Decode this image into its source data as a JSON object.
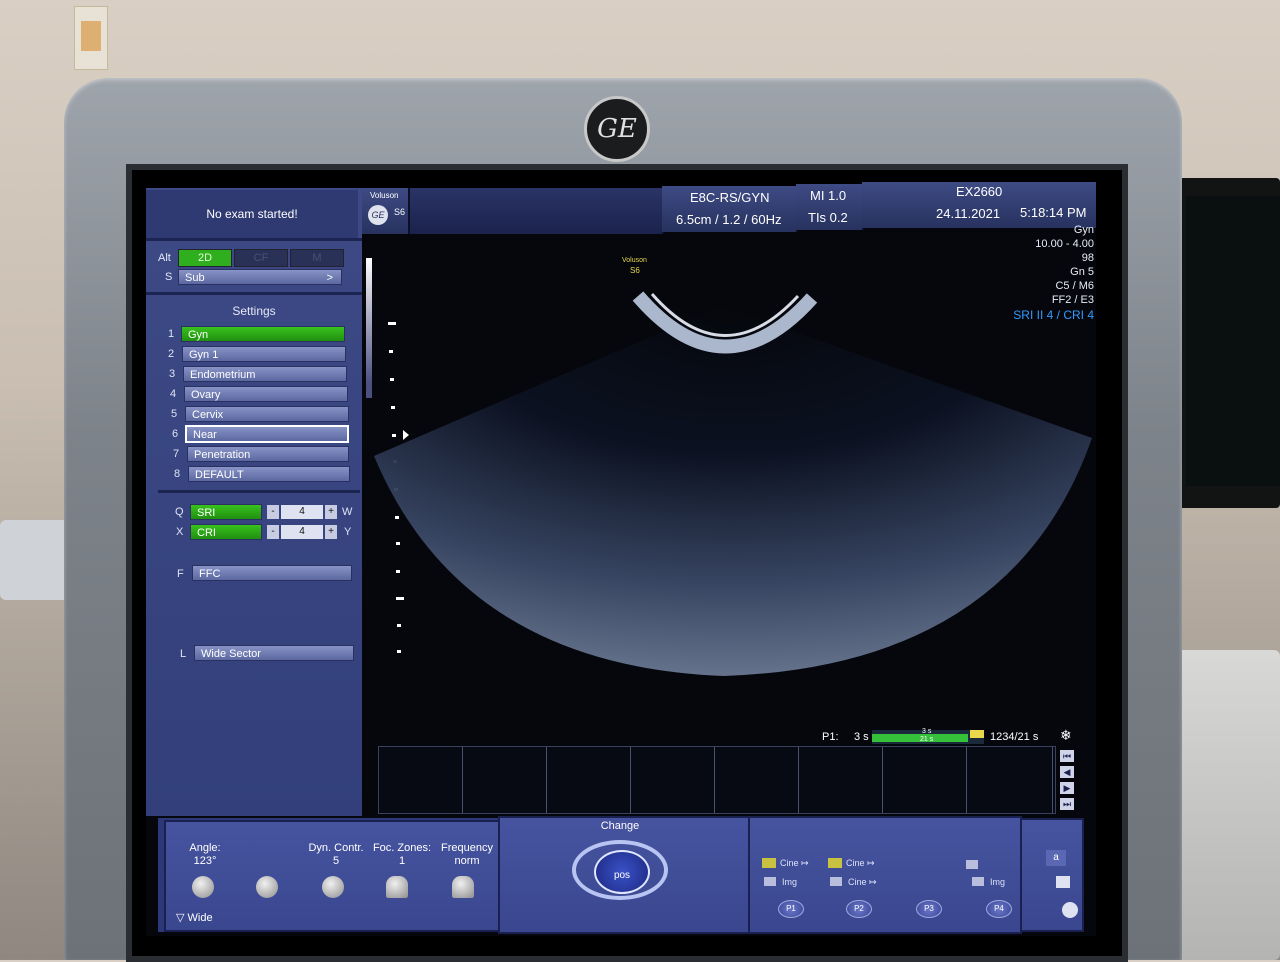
{
  "brand": {
    "monitor_logo": "GE",
    "product": "Voluson",
    "model": "S6"
  },
  "left_panel": {
    "exam_status": "No exam started!",
    "mode_row": {
      "label": "Alt",
      "modes": [
        "2D",
        "CF",
        "M"
      ]
    },
    "sub_row": {
      "key": "S",
      "label": "Sub",
      "arrow": ">"
    },
    "settings_title": "Settings",
    "settings": [
      {
        "num": "1",
        "label": "Gyn"
      },
      {
        "num": "2",
        "label": "Gyn 1"
      },
      {
        "num": "3",
        "label": "Endometrium"
      },
      {
        "num": "4",
        "label": "Ovary"
      },
      {
        "num": "5",
        "label": "Cervix"
      },
      {
        "num": "6",
        "label": "Near"
      },
      {
        "num": "7",
        "label": "Penetration"
      },
      {
        "num": "8",
        "label": "DEFAULT"
      }
    ],
    "sri": {
      "key": "Q",
      "label": "SRI",
      "minus": "-",
      "value": "4",
      "plus": "+",
      "suffix": "W"
    },
    "cri": {
      "key": "X",
      "label": "CRI",
      "minus": "-",
      "value": "4",
      "plus": "+",
      "suffix": "Y"
    },
    "ffc": {
      "key": "F",
      "label": "FFC"
    },
    "wide": {
      "key": "L",
      "label": "Wide Sector"
    }
  },
  "header": {
    "probe": "E8C-RS/GYN",
    "mi": "MI  1.0",
    "params": "6.5cm / 1.2 / 60Hz",
    "tis": "TIs  0.2",
    "patient": "EX2660",
    "date": "24.11.2021",
    "time": "5:18:14 PM"
  },
  "image_info": {
    "lines": [
      "Gyn",
      "10.00 - 4.00",
      "98",
      "Gn   5",
      "C5 / M6",
      "FF2 / E3"
    ],
    "sri_cri": "SRI II 4 / CRI 4",
    "image_label_line1": "Voluson",
    "image_label_line2": "S6",
    "accent_color": "#2f9bff"
  },
  "cine": {
    "p_label": "P1:",
    "left_time": "3 s",
    "bar_top": "3 s",
    "bar_bottom": "21 s",
    "frames": "1234/21 s",
    "freeze_icon": "snowflake-icon",
    "nav": [
      "⏮",
      "◀",
      "▶",
      "⏭"
    ]
  },
  "bottom": {
    "angle_label": "Angle:",
    "angle_value": "123°",
    "dyn_label": "Dyn. Contr.",
    "dyn_value": "5",
    "foc_label": "Foc. Zones:",
    "foc_value": "1",
    "freq_label": "Frequency",
    "freq_value": "norm",
    "wide_label": "▽ Wide",
    "change_label": "Change",
    "pos_label": "pos",
    "save_slots": [
      {
        "top": "Cine ↦",
        "bottom": "Img"
      },
      {
        "top": "Cine ↦",
        "bottom": "Cine ↦"
      },
      {
        "top": "",
        "bottom": ""
      },
      {
        "top": "",
        "bottom": "Img"
      }
    ],
    "p_buttons": [
      "P1",
      "P2",
      "P3",
      "P4"
    ],
    "side_key": "a"
  }
}
